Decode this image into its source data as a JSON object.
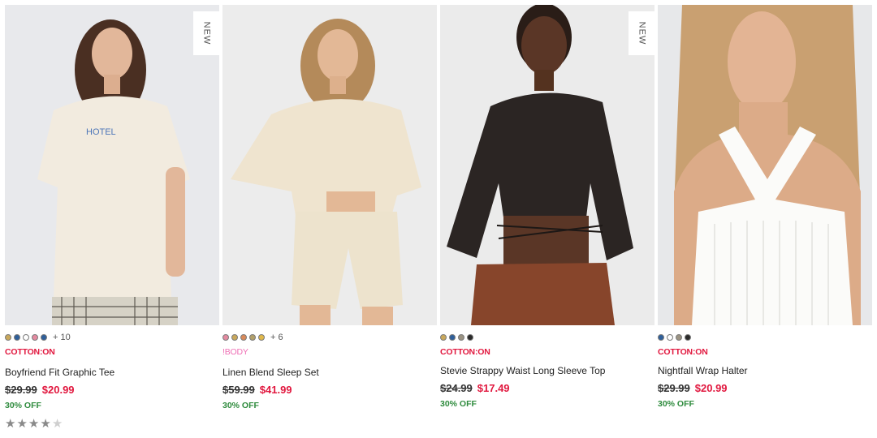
{
  "products": [
    {
      "badge": "",
      "swatches": [
        "#c9a85b",
        "#2f5f9a",
        "#ffffff",
        "#e48aa0",
        "#2f5f9a"
      ],
      "swatch_more": "+ 10",
      "brand": "COTTON:ON",
      "brand_color": "#e1173e",
      "title": "Boyfriend Fit Graphic Tee",
      "old_price": "$29.99",
      "new_price": "$20.99",
      "discount": "30% OFF",
      "rating": 4.5
    },
    {
      "badge": "",
      "swatches": [
        "#e48aa0",
        "#c9a85b",
        "#d98a5a",
        "#b2a06a",
        "#e0b84b"
      ],
      "swatch_more": "+ 6",
      "brand": "!BODY",
      "brand_color": "#ef6fb5",
      "title": "Linen Blend Sleep Set",
      "old_price": "$59.99",
      "new_price": "$41.99",
      "discount": "30% OFF"
    },
    {
      "badge": "NEW",
      "swatches": [
        "#c9a85b",
        "#2f5f9a",
        "#9b9383",
        "#2a2a2a"
      ],
      "swatch_more": "",
      "brand": "COTTON:ON",
      "brand_color": "#e1173e",
      "title": "Stevie Strappy Waist Long Sleeve Top",
      "old_price": "$24.99",
      "new_price": "$17.49",
      "discount": "30% OFF"
    },
    {
      "badge": "",
      "swatches": [
        "#2f5f9a",
        "#ffffff",
        "#9b9383",
        "#2a2a2a"
      ],
      "swatch_more": "",
      "brand": "COTTON:ON",
      "brand_color": "#e1173e",
      "title": "Nightfall Wrap Halter",
      "old_price": "$29.99",
      "new_price": "$20.99",
      "discount": "30% OFF"
    }
  ],
  "first_card_badge": "NEW",
  "star_glyph": "★"
}
